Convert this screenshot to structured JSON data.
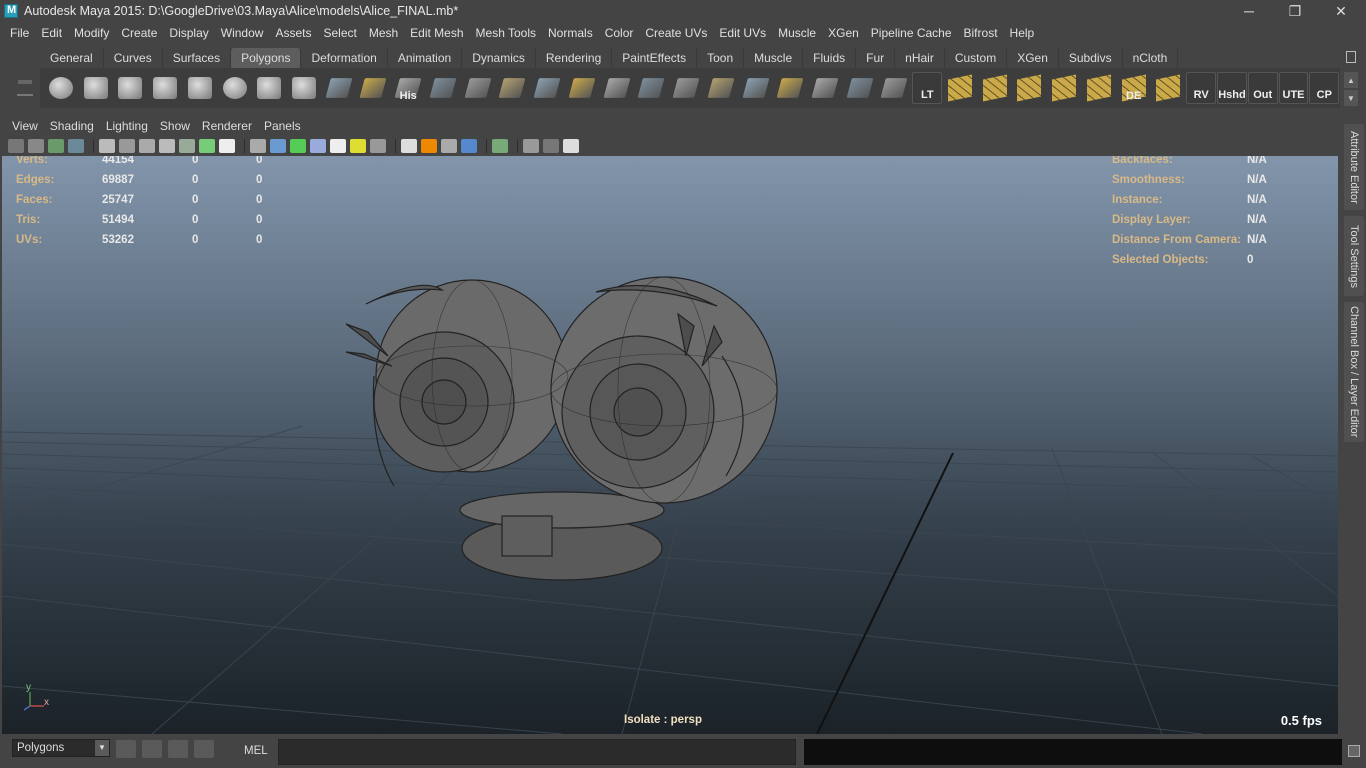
{
  "window": {
    "title": "Autodesk Maya 2015: D:\\GoogleDrive\\03.Maya\\Alice\\models\\Alice_FINAL.mb*",
    "minimize": "─",
    "maximize": "❐",
    "close": "✕"
  },
  "menubar": [
    "File",
    "Edit",
    "Modify",
    "Create",
    "Display",
    "Window",
    "Assets",
    "Select",
    "Mesh",
    "Edit Mesh",
    "Mesh Tools",
    "Normals",
    "Color",
    "Create UVs",
    "Edit UVs",
    "Muscle",
    "XGen",
    "Pipeline Cache",
    "Bifrost",
    "Help"
  ],
  "shelf_tabs": [
    "General",
    "Curves",
    "Surfaces",
    "Polygons",
    "Deformation",
    "Animation",
    "Dynamics",
    "Rendering",
    "PaintEffects",
    "Toon",
    "Muscle",
    "Fluids",
    "Fur",
    "nHair",
    "Custom",
    "XGen",
    "Subdivs",
    "nCloth"
  ],
  "active_shelf_tab": "Polygons",
  "shelf_icons": [
    {
      "name": "poly-sphere-icon",
      "label": ""
    },
    {
      "name": "poly-cube-icon",
      "label": ""
    },
    {
      "name": "poly-cylinder-icon",
      "label": ""
    },
    {
      "name": "poly-cone-icon",
      "label": ""
    },
    {
      "name": "poly-plane-icon",
      "label": ""
    },
    {
      "name": "poly-torus-icon",
      "label": ""
    },
    {
      "name": "poly-pyramid-icon",
      "label": ""
    },
    {
      "name": "poly-pipe-icon",
      "label": ""
    },
    {
      "name": "create-polygon-tool-icon",
      "label": ""
    },
    {
      "name": "append-polygon-icon",
      "label": ""
    },
    {
      "name": "history-icon",
      "label": "His"
    },
    {
      "name": "extrude-icon",
      "label": ""
    },
    {
      "name": "bevel-icon",
      "label": ""
    },
    {
      "name": "bridge-icon",
      "label": ""
    },
    {
      "name": "split-icon",
      "label": ""
    },
    {
      "name": "insert-edge-loop-icon",
      "label": ""
    },
    {
      "name": "combine-icon",
      "label": ""
    },
    {
      "name": "separate-icon",
      "label": ""
    },
    {
      "name": "fill-hole-icon",
      "label": ""
    },
    {
      "name": "sculpt-tool-icon",
      "label": ""
    },
    {
      "name": "paint-tool-icon",
      "label": ""
    },
    {
      "name": "lattice-icon",
      "label": ""
    },
    {
      "name": "universal-manipulator-icon",
      "label": ""
    },
    {
      "name": "soft-modification-icon",
      "label": ""
    },
    {
      "name": "pivot-icon",
      "label": ""
    },
    {
      "name": "lt-shelf-button",
      "label": "LT"
    },
    {
      "name": "uv-planar-icon",
      "label": ""
    },
    {
      "name": "uv-cylindrical-icon",
      "label": ""
    },
    {
      "name": "uv-spherical-icon",
      "label": ""
    },
    {
      "name": "uv-automatic-icon",
      "label": ""
    },
    {
      "name": "uv-editor-icon",
      "label": ""
    },
    {
      "name": "de-shelf-button",
      "label": "DE"
    },
    {
      "name": "uv-layout-icon",
      "label": ""
    },
    {
      "name": "rv-shelf-button",
      "label": "RV"
    },
    {
      "name": "hshd-shelf-button",
      "label": "Hshd"
    },
    {
      "name": "out-shelf-button",
      "label": "Out"
    },
    {
      "name": "ute-shelf-button",
      "label": "UTE"
    },
    {
      "name": "cp-shelf-button",
      "label": "CP"
    }
  ],
  "panel_menus": [
    "View",
    "Shading",
    "Lighting",
    "Show",
    "Renderer",
    "Panels"
  ],
  "hud_left": [
    {
      "label": "Verts:",
      "a": "44154",
      "b": "0",
      "c": "0"
    },
    {
      "label": "Edges:",
      "a": "69887",
      "b": "0",
      "c": "0"
    },
    {
      "label": "Faces:",
      "a": "25747",
      "b": "0",
      "c": "0"
    },
    {
      "label": "Tris:",
      "a": "51494",
      "b": "0",
      "c": "0"
    },
    {
      "label": "UVs:",
      "a": "53262",
      "b": "0",
      "c": "0"
    }
  ],
  "hud_right": [
    {
      "label": "Backfaces:",
      "value": "N/A"
    },
    {
      "label": "Smoothness:",
      "value": "N/A"
    },
    {
      "label": "Instance:",
      "value": "N/A"
    },
    {
      "label": "Display Layer:",
      "value": "N/A"
    },
    {
      "label": "Distance From Camera:",
      "value": "N/A"
    },
    {
      "label": "Selected Objects:",
      "value": "0"
    }
  ],
  "viewport": {
    "isolate": "Isolate : persp",
    "fps": "0.5 fps",
    "axis_x": "x",
    "axis_y": "y"
  },
  "side_tabs": [
    "Attribute Editor",
    "Tool Settings",
    "Channel Box / Layer Editor"
  ],
  "bottom": {
    "mode": "Polygons",
    "mel_label": "MEL",
    "command_value": ""
  },
  "colors": {
    "hud_label": "#d9b986",
    "shelf_yellow": "#c9a94a",
    "bg": "#444444"
  }
}
